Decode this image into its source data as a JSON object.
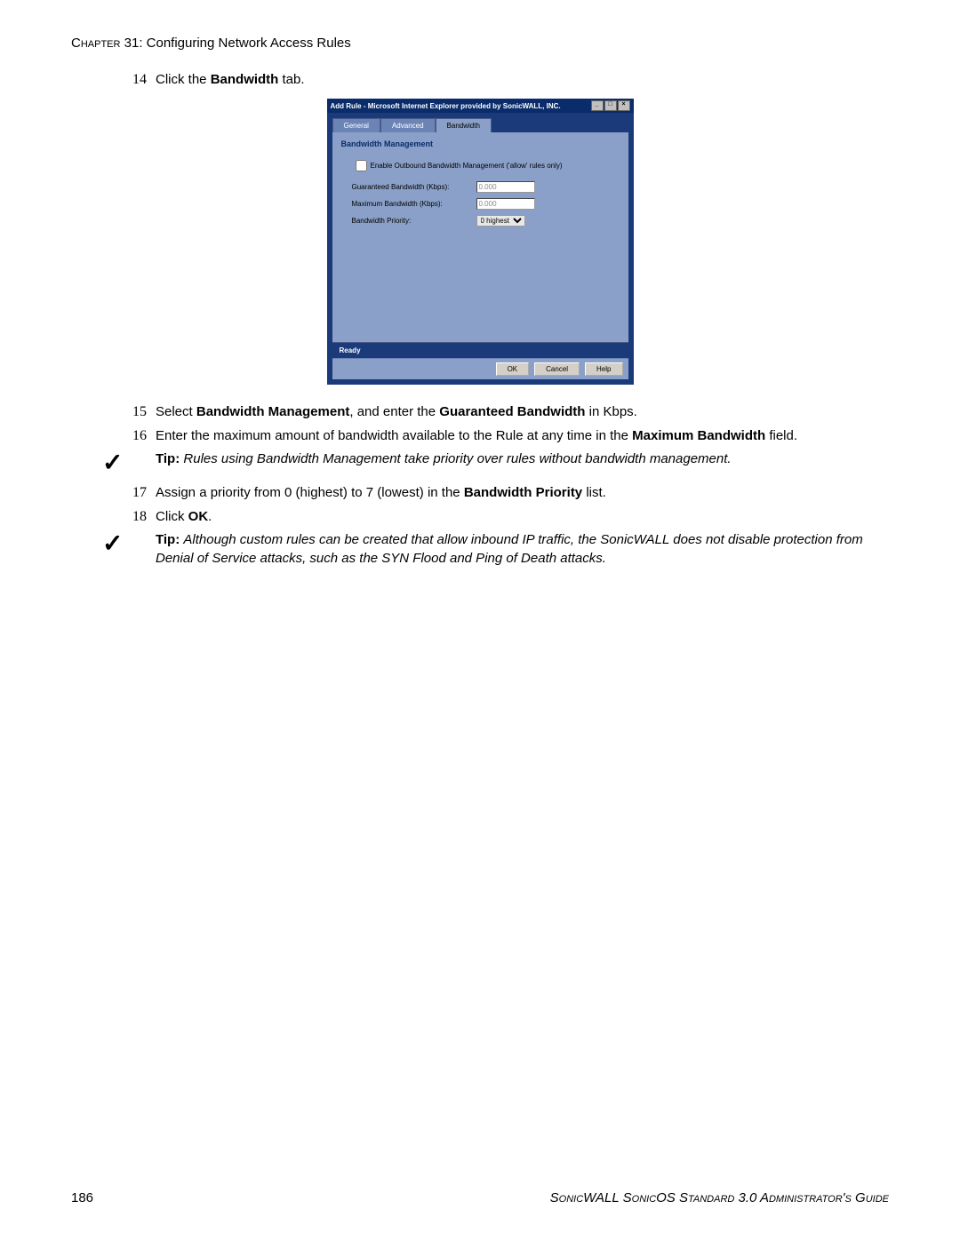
{
  "header": {
    "chapter_label": "Chapter",
    "chapter_num": "31",
    "chapter_title": ": Configuring Network Access Rules"
  },
  "steps": {
    "s14": {
      "num": "14",
      "pre": "Click the ",
      "bold": "Bandwidth",
      "post": " tab."
    },
    "s15": {
      "num": "15",
      "pre": "Select ",
      "b1": "Bandwidth Management",
      "mid": ", and enter the ",
      "b2": "Guaranteed Bandwidth",
      "post": " in Kbps."
    },
    "s16": {
      "num": "16",
      "pre": "Enter the maximum amount of bandwidth available to the Rule at any time in the ",
      "b1": "Maximum Bandwidth",
      "post": " field."
    },
    "s17": {
      "num": "17",
      "pre": "Assign a priority from 0 (highest) to 7 (lowest) in the ",
      "b1": "Bandwidth Priority",
      "post": " list."
    },
    "s18": {
      "num": "18",
      "pre": "Click ",
      "b1": "OK",
      "post": "."
    }
  },
  "tips": {
    "t1": {
      "label": "Tip:",
      "body": "Rules using Bandwidth Management take priority over rules without bandwidth management."
    },
    "t2": {
      "label": "Tip:",
      "body": "Although custom rules can be created that allow inbound IP traffic, the SonicWALL does not disable protection from Denial of Service attacks, such as the SYN Flood and Ping of Death attacks."
    }
  },
  "dialog": {
    "title": "Add Rule - Microsoft Internet Explorer provided by SonicWALL, INC.",
    "tabs": {
      "general": "General",
      "advanced": "Advanced",
      "bandwidth": "Bandwidth"
    },
    "panel_title": "Bandwidth Management",
    "enable_label": "Enable Outbound Bandwidth Management ('allow' rules only)",
    "guaranteed_label": "Guaranteed Bandwidth (Kbps):",
    "guaranteed_value": "0.000",
    "maximum_label": "Maximum Bandwidth (Kbps):",
    "maximum_value": "0.000",
    "priority_label": "Bandwidth Priority:",
    "priority_value": "0 highest",
    "status": "Ready",
    "ok": "OK",
    "cancel": "Cancel",
    "help": "Help"
  },
  "footer": {
    "page_num": "186",
    "guide": "SonicWALL SonicOS Standard 3.0 Administrator's Guide"
  }
}
